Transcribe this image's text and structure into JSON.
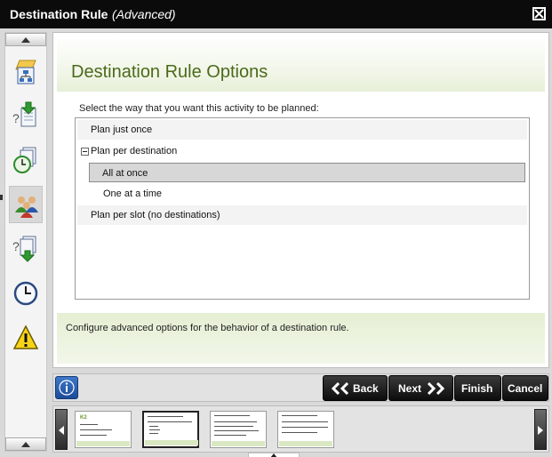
{
  "window": {
    "title": "Destination Rule",
    "subtitle": "(Advanced)",
    "close_icon": "close-x-icon"
  },
  "sidebar": {
    "items": [
      {
        "icon": "hierarchy-plan-icon"
      },
      {
        "icon": "question-document-down-icon"
      },
      {
        "icon": "documents-clock-icon"
      },
      {
        "icon": "people-group-icon",
        "selected": true
      },
      {
        "icon": "question-documents-down-icon"
      },
      {
        "icon": "clock-icon"
      },
      {
        "icon": "warning-icon"
      }
    ]
  },
  "page": {
    "heading": "Destination Rule Options",
    "prompt": "Select the way that you want this activity to be planned:",
    "options": [
      {
        "label": "Plan just once"
      },
      {
        "label": "Plan per destination",
        "expanded": true
      },
      {
        "label": "All at once",
        "selected": true
      },
      {
        "label": "One at a time"
      },
      {
        "label": "Plan per slot (no destinations)"
      }
    ],
    "description": "Configure advanced options for the behavior of a destination rule."
  },
  "toolbar": {
    "info_icon": "info-icon",
    "back_label": "Back",
    "next_label": "Next",
    "finish_label": "Finish",
    "cancel_label": "Cancel"
  },
  "thumbnails": {
    "logo_text": "K2",
    "count": 4,
    "active_index": 1
  },
  "colors": {
    "heading": "#4b6a19",
    "header_gradient": "#e6efd6",
    "footer_gradient": "#e5efd3",
    "button_bg": "#111111"
  }
}
